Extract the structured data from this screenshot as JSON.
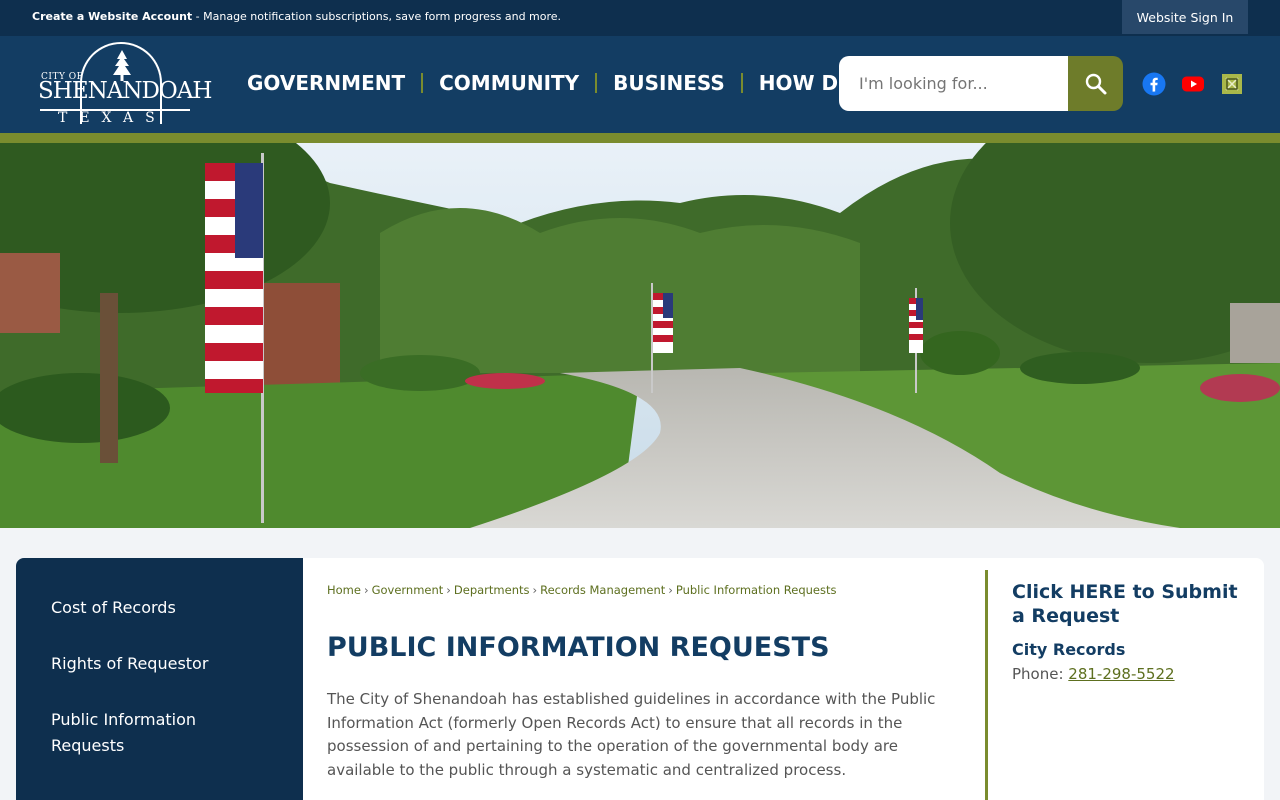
{
  "topbar": {
    "create_account": "Create a Website Account",
    "message": " - Manage notification subscriptions, save form progress and more.",
    "signin": "Website Sign In"
  },
  "logo": {
    "city_of": "CITY OF",
    "name": "SHENANDOAH",
    "state": "TEXAS"
  },
  "nav": {
    "items": [
      "GOVERNMENT",
      "COMMUNITY",
      "BUSINESS",
      "HOW DO I..."
    ]
  },
  "search": {
    "placeholder": "I'm looking for..."
  },
  "social": [
    "facebook-icon",
    "youtube-icon",
    "k-icon"
  ],
  "colors": {
    "navy": "#133d63",
    "dark_navy": "#0e2f4e",
    "olive": "#7a8c2e",
    "link_olive": "#5d6f1f"
  },
  "sidebar": {
    "items": [
      {
        "label": "Cost of Records"
      },
      {
        "label": "Rights of Requestor"
      },
      {
        "label": "Public Information Requests"
      }
    ]
  },
  "breadcrumb": {
    "items": [
      "Home",
      "Government",
      "Departments",
      "Records Management",
      "Public Information Requests"
    ],
    "separator": "›"
  },
  "main": {
    "title": "PUBLIC INFORMATION REQUESTS",
    "body": "The City of Shenandoah has established guidelines in accordance with the Public Information Act (formerly Open Records Act) to ensure that all records in the possession of and pertaining to the operation of the governmental body are available to the public through a systematic and centralized process."
  },
  "right": {
    "cta": "Click HERE to Submit a Request",
    "subheading": "City Records",
    "phone_label": "Phone: ",
    "phone": "281-298-5522"
  }
}
